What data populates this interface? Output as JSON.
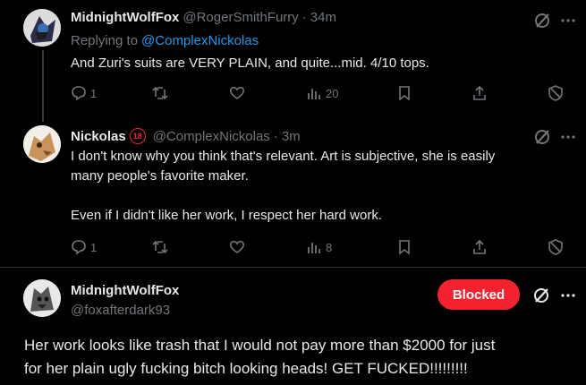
{
  "tweets": [
    {
      "display_name": "MidnightWolfFox",
      "handle": "@RogerSmithFurry",
      "separator": "·",
      "time": "34m",
      "replying_prefix": "Replying to",
      "replying_to": "@ComplexNickolas",
      "text": "And Zuri's suits are VERY PLAIN, and quite...mid. 4/10 tops.",
      "replies": "1",
      "views": "20"
    },
    {
      "display_name": "Nickolas",
      "badge": "18",
      "handle": "@ComplexNickolas",
      "separator": "·",
      "time": "3m",
      "text_line1": "I don't know why you think that's relevant. Art is subjective, she is easily",
      "text_line2": "many people's favorite maker.",
      "text_line3": "Even if I didn't like her work, I respect her hard work.",
      "replies": "1",
      "views": "8"
    }
  ],
  "main_tweet": {
    "display_name": "MidnightWolfFox",
    "handle": "@foxafterdark93",
    "blocked_label": "Blocked",
    "text_line1": "Her work looks like trash that I would not pay more than $2000 for just",
    "text_line2": "for her plain ugly fucking bitch looking heads! GET FUCKED!!!!!!!!!"
  },
  "icons": [
    "grok-icon",
    "more-icon",
    "reply-icon",
    "retweet-icon",
    "like-icon",
    "views-icon",
    "bookmark-icon",
    "share-icon",
    "block-icon"
  ],
  "colors": {
    "accent": "#1d9bf0",
    "blocked": "#f4212e",
    "muted": "#71767b",
    "text": "#e7e9ea"
  }
}
